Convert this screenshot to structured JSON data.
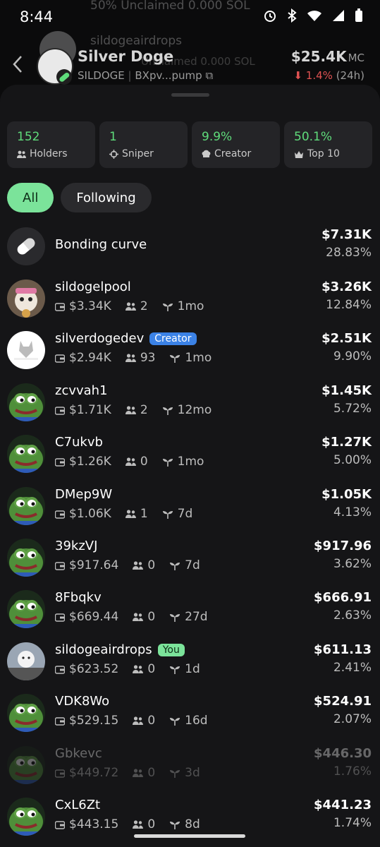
{
  "status": {
    "time": "8:44"
  },
  "background_rows": [
    {
      "title": "50% Unclaimed 0.000 SOL"
    },
    {
      "title": "sildogeairdrops",
      "sub": "Unclaimed 0.000 SOL"
    }
  ],
  "token": {
    "name": "Silver Doge",
    "symbol": "SILDOGE",
    "address": "BXpv...pump",
    "market_cap": "$25.4K",
    "mc_label": "MC",
    "change": "1.4%",
    "change_period": "(24h)",
    "colors": {
      "negative": "#e05252",
      "accent_green": "#5fdc7b"
    }
  },
  "stats": [
    {
      "value": "152",
      "label": "Holders",
      "icon": "users-icon"
    },
    {
      "value": "1",
      "label": "Sniper",
      "icon": "crosshair-icon"
    },
    {
      "value": "9.9%",
      "label": "Creator",
      "icon": "chef-hat-icon"
    },
    {
      "value": "50.1%",
      "label": "Top 10",
      "icon": "crown-icon"
    }
  ],
  "filters": {
    "all": "All",
    "following": "Following"
  },
  "bonding": {
    "name": "Bonding curve",
    "value": "$7.31K",
    "pct": "28.83%"
  },
  "holders": [
    {
      "name": "sildogelpool",
      "badge": "",
      "bal": "$3.34K",
      "followers": "2",
      "age": "1mo",
      "value": "$3.26K",
      "pct": "12.84%",
      "avatar": "pool"
    },
    {
      "name": "silverdogedev",
      "badge": "Creator",
      "bal": "$2.94K",
      "followers": "93",
      "age": "1mo",
      "value": "$2.51K",
      "pct": "9.90%",
      "avatar": "logo"
    },
    {
      "name": "zcvvah1",
      "badge": "",
      "bal": "$1.71K",
      "followers": "2",
      "age": "12mo",
      "value": "$1.45K",
      "pct": "5.72%",
      "avatar": "pepe"
    },
    {
      "name": "C7ukvb",
      "badge": "",
      "bal": "$1.26K",
      "followers": "0",
      "age": "1mo",
      "value": "$1.27K",
      "pct": "5.00%",
      "avatar": "pepe"
    },
    {
      "name": "DMep9W",
      "badge": "",
      "bal": "$1.06K",
      "followers": "1",
      "age": "7d",
      "value": "$1.05K",
      "pct": "4.13%",
      "avatar": "pepe"
    },
    {
      "name": "39kzVJ",
      "badge": "",
      "bal": "$917.64",
      "followers": "0",
      "age": "7d",
      "value": "$917.96",
      "pct": "3.62%",
      "avatar": "pepe"
    },
    {
      "name": "8Fbqkv",
      "badge": "",
      "bal": "$669.44",
      "followers": "0",
      "age": "27d",
      "value": "$666.91",
      "pct": "2.63%",
      "avatar": "pepe"
    },
    {
      "name": "sildogeairdrops",
      "badge": "You",
      "bal": "$623.52",
      "followers": "0",
      "age": "1d",
      "value": "$611.13",
      "pct": "2.41%",
      "avatar": "dog"
    },
    {
      "name": "VDK8Wo",
      "badge": "",
      "bal": "$529.15",
      "followers": "0",
      "age": "16d",
      "value": "$524.91",
      "pct": "2.07%",
      "avatar": "pepe"
    },
    {
      "name": "Gbkevc",
      "badge": "",
      "bal": "$449.72",
      "followers": "0",
      "age": "3d",
      "value": "$446.30",
      "pct": "1.76%",
      "avatar": "pepe",
      "faded": true
    },
    {
      "name": "CxL6Zt",
      "badge": "",
      "bal": "$443.15",
      "followers": "0",
      "age": "8d",
      "value": "$441.23",
      "pct": "1.74%",
      "avatar": "pepe"
    }
  ]
}
